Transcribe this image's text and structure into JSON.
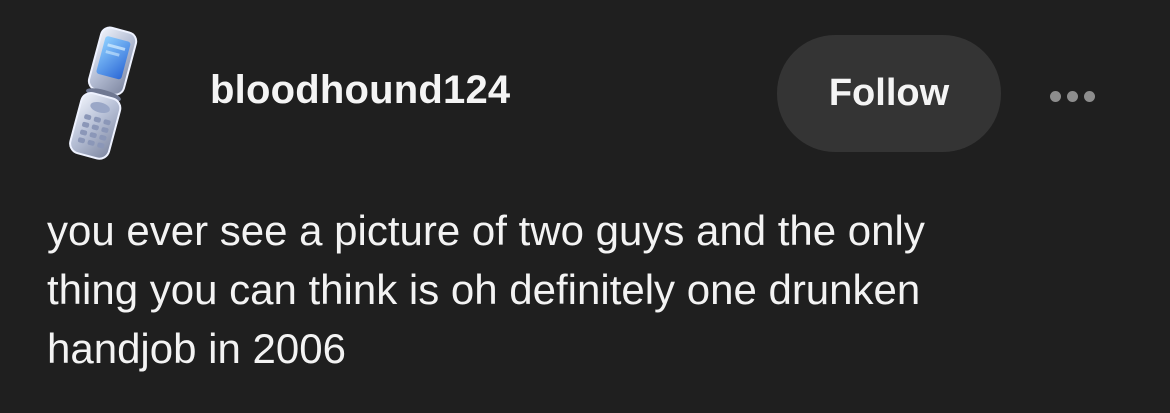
{
  "post": {
    "author": {
      "username": "bloodhound124",
      "avatar_icon": "flip-phone-icon"
    },
    "follow_label": "Follow",
    "more_icon": "ellipsis-icon",
    "body_text": "you ever see a picture of two guys and the only\nthing you can think is oh definitely one drunken\nhandjob in 2006"
  }
}
